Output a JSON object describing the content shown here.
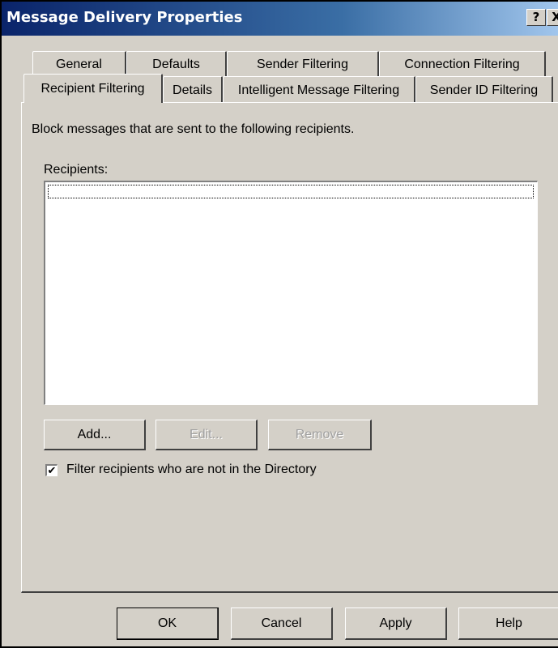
{
  "window": {
    "title": "Message Delivery Properties",
    "help_glyph": "?",
    "close_glyph": "X"
  },
  "tabs": {
    "row1": [
      {
        "label": "General"
      },
      {
        "label": "Defaults"
      },
      {
        "label": "Sender Filtering"
      },
      {
        "label": "Connection Filtering"
      }
    ],
    "row2": [
      {
        "label": "Recipient Filtering",
        "selected": true
      },
      {
        "label": "Details"
      },
      {
        "label": "Intelligent Message Filtering"
      },
      {
        "label": "Sender ID Filtering"
      }
    ]
  },
  "panel": {
    "description": "Block messages that are sent to the following recipients.",
    "recipients_label": "Recipients:",
    "recipients": [],
    "add_label": "Add...",
    "edit_label": "Edit...",
    "remove_label": "Remove",
    "filter_checkbox_label": "Filter recipients who are not in the Directory",
    "filter_checked": true
  },
  "footer": {
    "ok_label": "OK",
    "cancel_label": "Cancel",
    "apply_label": "Apply",
    "help_label": "Help"
  }
}
